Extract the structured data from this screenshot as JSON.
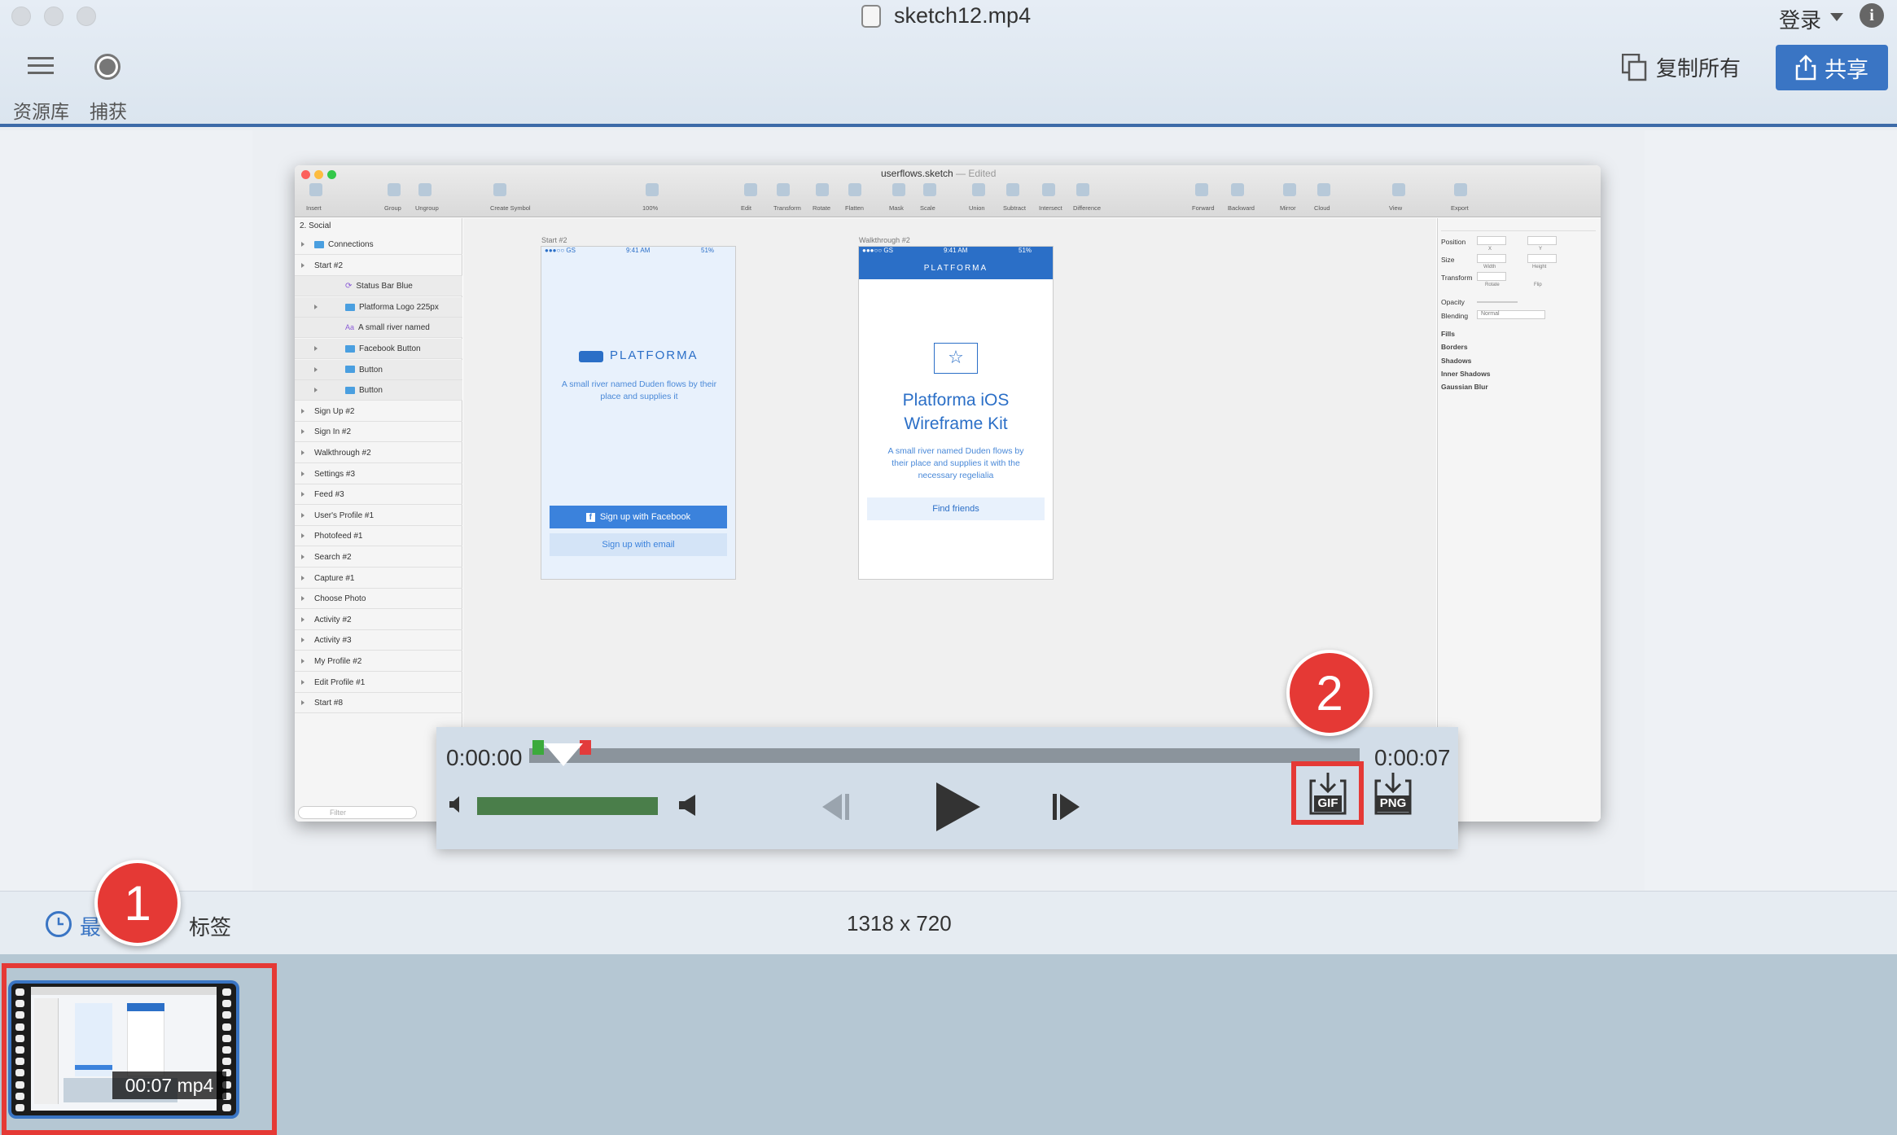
{
  "window": {
    "title": "sketch12.mp4"
  },
  "toolbar": {
    "library_label": "资源库",
    "capture_label": "捕获",
    "login_label": "登录",
    "copy_all_label": "复制所有",
    "share_label": "共享"
  },
  "sketch": {
    "title": "userflows.sketch",
    "title_suffix": "— Edited",
    "toolbar_items": [
      "Insert",
      "Group",
      "Ungroup",
      "Create Symbol",
      "100%",
      "Edit",
      "Transform",
      "Rotate",
      "Flatten",
      "Mask",
      "Scale",
      "Union",
      "Subtract",
      "Intersect",
      "Difference",
      "Forward",
      "Backward",
      "Mirror",
      "Cloud",
      "View",
      "Export"
    ],
    "page_selector": "2. Social",
    "layers": [
      {
        "name": "Connections",
        "indent": 0,
        "type": "folder"
      },
      {
        "name": "Start #2",
        "indent": 0,
        "type": "artboard"
      },
      {
        "name": "Status Bar Blue",
        "indent": 1,
        "type": "symbol"
      },
      {
        "name": "Platforma Logo 225px",
        "indent": 1,
        "type": "folder"
      },
      {
        "name": "A small river named",
        "indent": 1,
        "type": "text"
      },
      {
        "name": "Facebook Button",
        "indent": 1,
        "type": "folder"
      },
      {
        "name": "Button",
        "indent": 1,
        "type": "folder"
      },
      {
        "name": "Button",
        "indent": 1,
        "type": "folder"
      },
      {
        "name": "Sign Up #2",
        "indent": 0,
        "type": "artboard"
      },
      {
        "name": "Sign In #2",
        "indent": 0,
        "type": "artboard"
      },
      {
        "name": "Walkthrough #2",
        "indent": 0,
        "type": "artboard"
      },
      {
        "name": "Settings #3",
        "indent": 0,
        "type": "artboard"
      },
      {
        "name": "Feed #3",
        "indent": 0,
        "type": "artboard"
      },
      {
        "name": "User's Profile #1",
        "indent": 0,
        "type": "artboard"
      },
      {
        "name": "Photofeed #1",
        "indent": 0,
        "type": "artboard"
      },
      {
        "name": "Search #2",
        "indent": 0,
        "type": "artboard"
      },
      {
        "name": "Capture #1",
        "indent": 0,
        "type": "artboard"
      },
      {
        "name": "Choose Photo",
        "indent": 0,
        "type": "artboard"
      },
      {
        "name": "Activity #2",
        "indent": 0,
        "type": "artboard"
      },
      {
        "name": "Activity #3",
        "indent": 0,
        "type": "artboard"
      },
      {
        "name": "My Profile #2",
        "indent": 0,
        "type": "artboard"
      },
      {
        "name": "Edit Profile #1",
        "indent": 0,
        "type": "artboard"
      },
      {
        "name": "Start #8",
        "indent": 0,
        "type": "artboard"
      }
    ],
    "filter_placeholder": "Filter",
    "inspector": {
      "position": "Position",
      "x": "X",
      "y": "Y",
      "size": "Size",
      "width": "Width",
      "height": "Height",
      "transform": "Transform",
      "rotate": "Rotate",
      "flip": "Flip",
      "opacity": "Opacity",
      "blending": "Blending",
      "blending_value": "Normal",
      "fills": "Fills",
      "borders": "Borders",
      "shadows": "Shadows",
      "inner_shadows": "Inner Shadows",
      "gaussian_blur": "Gaussian Blur"
    },
    "artboard1": {
      "label": "Start #2",
      "status_left": "●●●○○ GS",
      "status_time": "9:41 AM",
      "status_right": "51%",
      "logo_text": "PLATFORMA",
      "tagline": "A small river named Duden flows by their place and supplies it",
      "fb_button": "Sign up with Facebook",
      "email_button": "Sign up with email"
    },
    "artboard2": {
      "label": "Walkthrough #2",
      "status_left": "●●●○○ GS",
      "status_time": "9:41 AM",
      "status_right": "51%",
      "header": "PLATFORMA",
      "title_line1": "Platforma iOS",
      "title_line2": "Wireframe Kit",
      "body": "A small river named Duden flows by their place and supplies it with the necessary regelialia",
      "button": "Find friends"
    }
  },
  "player": {
    "time_start": "0:00:00",
    "time_end": "0:00:07",
    "volume_level": 1.0,
    "gif_label": "GIF",
    "png_label": "PNG"
  },
  "bottom": {
    "recent_label": "最",
    "tags_label": "标签",
    "dimensions": "1318 x 720"
  },
  "thumbnail": {
    "duration": "00:07 mp4"
  },
  "badges": {
    "one": "1",
    "two": "2"
  },
  "colors": {
    "accent": "#3a75c4",
    "badge": "#e53935",
    "sketch_blue": "#2b6fc7"
  }
}
